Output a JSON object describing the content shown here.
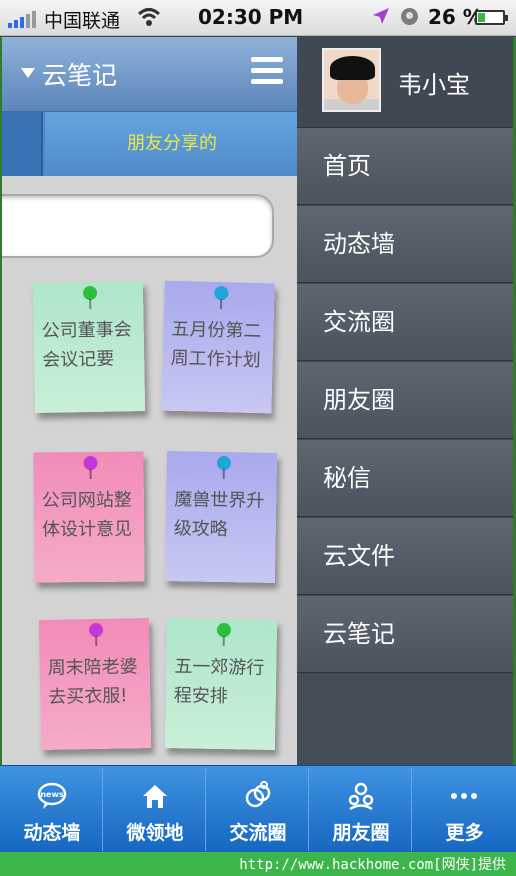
{
  "status_bar": {
    "carrier": "中国联通",
    "time": "02:30 PM",
    "battery_percent": "26 %",
    "battery_level": 0.26
  },
  "app": {
    "title": "云笔记",
    "tab_shared": "朋友分享的",
    "notes": [
      {
        "text": "公司董事会会议记要",
        "color": "green",
        "pin_color": "#2bbf3b"
      },
      {
        "text": "五月份第二周工作计划",
        "color": "purple",
        "pin_color": "#1fa6d6"
      },
      {
        "text": "公司网站整体设计意见",
        "color": "pink",
        "pin_color": "#c13ad9"
      },
      {
        "text": "魔兽世界升级攻略",
        "color": "purple",
        "pin_color": "#1fa6d6"
      },
      {
        "text": "周末陪老婆去买衣服!",
        "color": "pink",
        "pin_color": "#c13ad9"
      },
      {
        "text": "五一郊游行程安排",
        "color": "green",
        "pin_color": "#2bbf3b"
      }
    ]
  },
  "drawer": {
    "user_name": "韦小宝",
    "items": [
      {
        "label": "首页"
      },
      {
        "label": "动态墙"
      },
      {
        "label": "交流圈"
      },
      {
        "label": "朋友圈"
      },
      {
        "label": "秘信"
      },
      {
        "label": "云文件"
      },
      {
        "label": "云笔记"
      }
    ]
  },
  "tab_bar": {
    "tabs": [
      {
        "label": "动态墙",
        "icon": "news-bubble-icon"
      },
      {
        "label": "微领地",
        "icon": "home-icon"
      },
      {
        "label": "交流圈",
        "icon": "rings-icon"
      },
      {
        "label": "朋友圈",
        "icon": "people-icon"
      },
      {
        "label": "更多",
        "icon": "more-dots-icon"
      }
    ]
  },
  "footer": {
    "watermark": "http://www.hackhome.com[网侠]提供"
  },
  "colors": {
    "header_blue": "#5c86bb",
    "tab_text_yellow": "#e8e84a",
    "drawer_bg": "#3d4651",
    "tabbar_blue": "#1567c1"
  }
}
